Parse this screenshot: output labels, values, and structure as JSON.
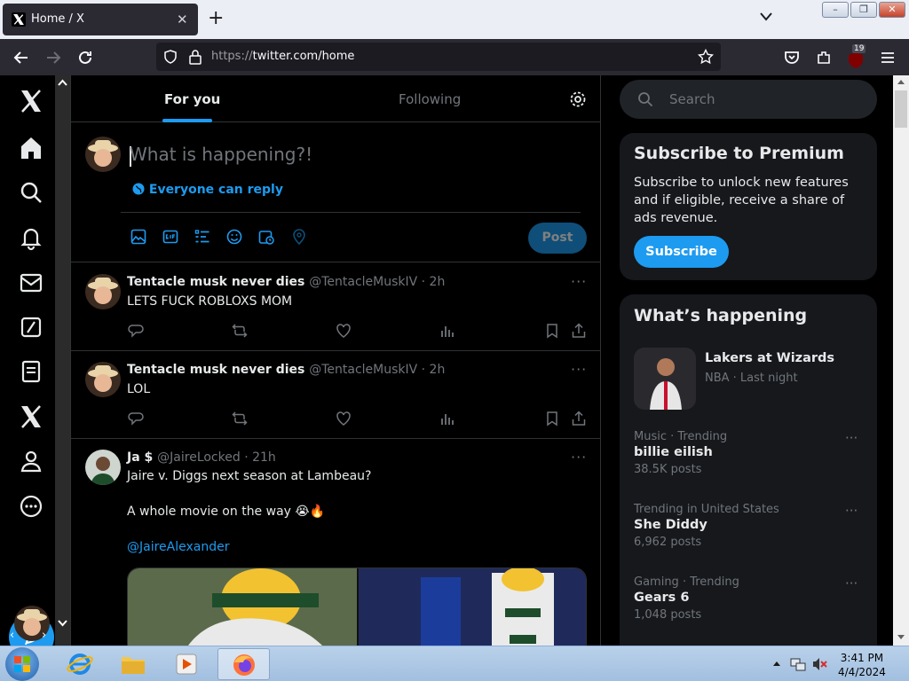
{
  "browser": {
    "tab_title": "Home / X",
    "tab_close": "✕",
    "new_tab": "+",
    "url_scheme": "https://",
    "url_rest": "twitter.com/home",
    "extension_badge": "19"
  },
  "window_controls": {
    "minimize": "–",
    "restore": "❐",
    "close": "✕"
  },
  "header": {
    "tab_for_you": "For you",
    "tab_following": "Following"
  },
  "composer": {
    "placeholder": "What is happening?!",
    "reply_setting": "Everyone can reply",
    "post_label": "Post"
  },
  "tweets": [
    {
      "name": "Tentacle musk never dies",
      "handle": "@TentacleMuskIV · 2h",
      "text": "LETS FUCK ROBLOXS MOM",
      "more": "···"
    },
    {
      "name": "Tentacle musk never dies",
      "handle": "@TentacleMuskIV · 2h",
      "text": "LOL",
      "more": "···"
    },
    {
      "name": "Ja $",
      "handle": "@JaireLocked · 21h",
      "text_line1": "Jaire v. Diggs next season at Lambeau?",
      "text_line2": "A whole movie on the way 😭🔥",
      "mention": "@JaireAlexander",
      "more": "···"
    }
  ],
  "search": {
    "placeholder": "Search"
  },
  "premium": {
    "title": "Subscribe to Premium",
    "description": "Subscribe to unlock new features and if eligible, receive a share of ads revenue.",
    "button": "Subscribe"
  },
  "happening": {
    "title": "What’s happening",
    "featured": {
      "name": "Lakers at Wizards",
      "meta": "NBA · Last night"
    },
    "trends": [
      {
        "category": "Music · Trending",
        "name": "billie eilish",
        "count": "38.5K posts",
        "more": "···"
      },
      {
        "category": "Trending in United States",
        "name": "She Diddy",
        "count": "6,962 posts",
        "more": "···"
      },
      {
        "category": "Gaming · Trending",
        "name": "Gears 6",
        "count": "1,048 posts",
        "more": "···"
      }
    ]
  },
  "taskbar": {
    "time": "3:41 PM",
    "date": "4/4/2024"
  },
  "colors": {
    "accent": "#1d9bf0",
    "background": "#000000",
    "card": "#16181c",
    "muted": "#71767b"
  }
}
